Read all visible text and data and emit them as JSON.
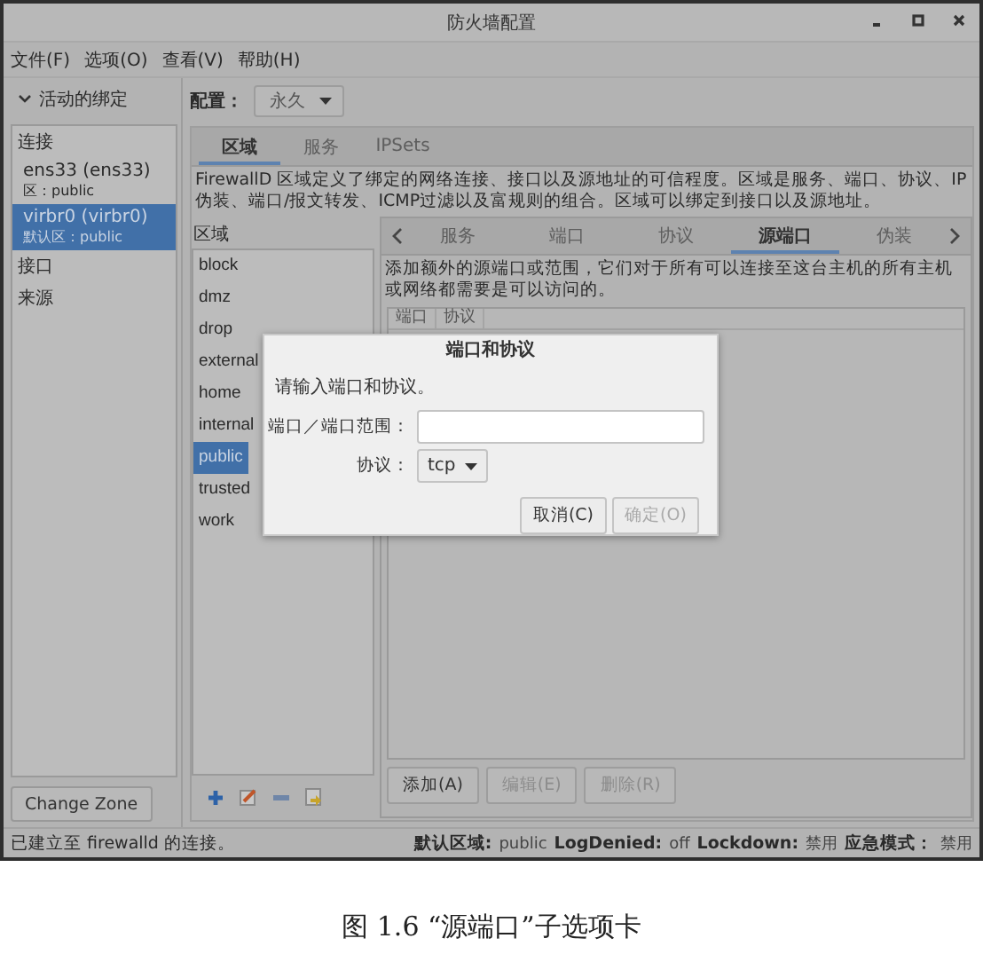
{
  "window": {
    "title": "防火墙配置"
  },
  "menu": [
    "文件(F)",
    "选项(O)",
    "查看(V)",
    "帮助(H)"
  ],
  "bindings": {
    "header": "活动的绑定",
    "expanded": true,
    "items": [
      {
        "kind": "header",
        "label": "连接",
        "selected": false
      },
      {
        "kind": "connection",
        "label": "ens33 (ens33)",
        "zone": "区：public",
        "selected": false
      },
      {
        "kind": "connection",
        "label": "virbr0 (virbr0)",
        "zone": "默认区：public",
        "selected": true
      },
      {
        "kind": "header",
        "label": "接口",
        "selected": false
      },
      {
        "kind": "header",
        "label": "来源",
        "selected": false
      }
    ],
    "button": "Change Zone"
  },
  "config": {
    "label": "配置：",
    "value": "永久"
  },
  "tabs": [
    {
      "label": "区域",
      "selected": true
    },
    {
      "label": "服务",
      "selected": false
    },
    {
      "label": "IPSets",
      "selected": false
    }
  ],
  "description": "FirewallD 区域定义了绑定的网络连接、接口以及源地址的可信程度。区域是服务、端口、协议、IP伪装、端口/报文转发、ICMP过滤以及富规则的组合。区域可以绑定到接口以及源地址。",
  "zones": {
    "heading": "区域",
    "items": [
      {
        "label": "block",
        "selected": false
      },
      {
        "label": "dmz",
        "selected": false
      },
      {
        "label": "drop",
        "selected": false
      },
      {
        "label": "external",
        "selected": false
      },
      {
        "label": "home",
        "selected": false
      },
      {
        "label": "internal",
        "selected": false
      },
      {
        "label": "public",
        "selected": true
      },
      {
        "label": "trusted",
        "selected": false
      },
      {
        "label": "work",
        "selected": false
      }
    ]
  },
  "zone_tabs": [
    {
      "label": "服务",
      "selected": false
    },
    {
      "label": "端口",
      "selected": false
    },
    {
      "label": "协议",
      "selected": false
    },
    {
      "label": "源端口",
      "selected": true
    },
    {
      "label": "伪装",
      "selected": false
    }
  ],
  "zone_tab_text": "添加额外的源端口或范围，它们对于所有可以连接至这台主机的所有主机或网络都需要是可以访问的。",
  "table": {
    "columns": [
      "端口",
      "协议"
    ]
  },
  "actions": [
    {
      "label": "添加(A)",
      "disabled": false
    },
    {
      "label": "编辑(E)",
      "disabled": true
    },
    {
      "label": "删除(R)",
      "disabled": true
    }
  ],
  "status_bar": {
    "message": "已建立至 firewalld 的连接。",
    "items": [
      {
        "label": "默认区域:",
        "value": "public"
      },
      {
        "label": "LogDenied:",
        "value": "off"
      },
      {
        "label": "Lockdown:",
        "value": "禁用"
      },
      {
        "label": "应急模式：",
        "value": "禁用"
      }
    ]
  },
  "dialog": {
    "title": "端口和协议",
    "prompt": "请输入端口和协议。",
    "port_label": "端口／端口范围：",
    "protocol_label": "协议：",
    "protocol": "tcp",
    "buttons": [
      {
        "label": "取消(C)",
        "disabled": false
      },
      {
        "label": "确定(O)",
        "disabled": true
      }
    ]
  },
  "caption": "图 1.6 “源端口”子选项卡"
}
